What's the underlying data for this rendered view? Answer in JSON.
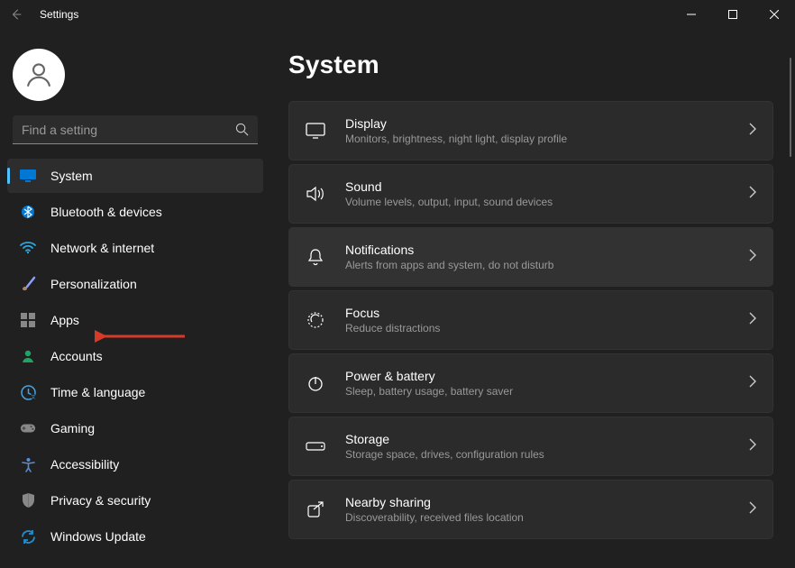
{
  "window": {
    "title": "Settings"
  },
  "search": {
    "placeholder": "Find a setting"
  },
  "sidebar": {
    "items": [
      {
        "label": "System",
        "icon": "monitor-icon",
        "active": true
      },
      {
        "label": "Bluetooth & devices",
        "icon": "bluetooth-icon"
      },
      {
        "label": "Network & internet",
        "icon": "wifi-icon"
      },
      {
        "label": "Personalization",
        "icon": "brush-icon"
      },
      {
        "label": "Apps",
        "icon": "apps-icon"
      },
      {
        "label": "Accounts",
        "icon": "person-icon"
      },
      {
        "label": "Time & language",
        "icon": "clock-icon"
      },
      {
        "label": "Gaming",
        "icon": "gamepad-icon"
      },
      {
        "label": "Accessibility",
        "icon": "accessibility-icon"
      },
      {
        "label": "Privacy & security",
        "icon": "shield-icon"
      },
      {
        "label": "Windows Update",
        "icon": "update-icon"
      }
    ]
  },
  "page": {
    "heading": "System",
    "cards": [
      {
        "title": "Display",
        "subtitle": "Monitors, brightness, night light, display profile",
        "icon": "display-icon"
      },
      {
        "title": "Sound",
        "subtitle": "Volume levels, output, input, sound devices",
        "icon": "sound-icon"
      },
      {
        "title": "Notifications",
        "subtitle": "Alerts from apps and system, do not disturb",
        "icon": "bell-icon",
        "hover": true
      },
      {
        "title": "Focus",
        "subtitle": "Reduce distractions",
        "icon": "focus-icon"
      },
      {
        "title": "Power & battery",
        "subtitle": "Sleep, battery usage, battery saver",
        "icon": "power-icon"
      },
      {
        "title": "Storage",
        "subtitle": "Storage space, drives, configuration rules",
        "icon": "storage-icon"
      },
      {
        "title": "Nearby sharing",
        "subtitle": "Discoverability, received files location",
        "icon": "share-icon"
      }
    ]
  }
}
